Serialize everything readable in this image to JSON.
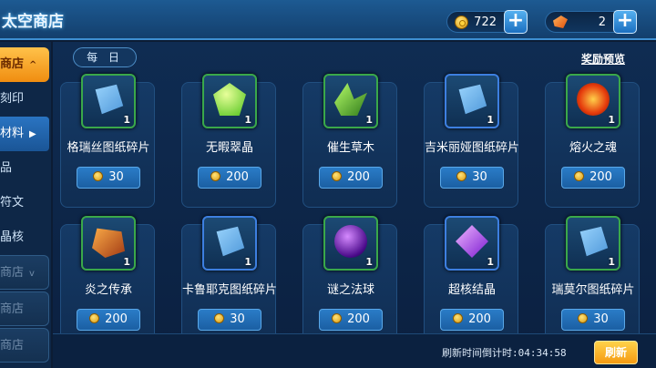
{
  "header": {
    "title": "太空商店",
    "currency1": {
      "icon": "coin-icon",
      "value": "722"
    },
    "currency2": {
      "icon": "gem-icon",
      "value": "2"
    }
  },
  "sidebar": {
    "items": [
      {
        "label": "商店"
      },
      {
        "label": "刻印"
      },
      {
        "label": "材料"
      },
      {
        "label": "品"
      },
      {
        "label": "符文"
      },
      {
        "label": "晶核"
      },
      {
        "label": "商店"
      },
      {
        "label": "商店"
      },
      {
        "label": "商店"
      }
    ]
  },
  "main": {
    "tab_daily": "每 日",
    "preview_link": "奖励预览",
    "items": [
      {
        "name": "格瑞丝图纸碎片",
        "price": "30",
        "count": "1",
        "icon": "blueprint-icon"
      },
      {
        "name": "无暇翠晶",
        "price": "200",
        "count": "1",
        "icon": "green-crystal-icon"
      },
      {
        "name": "催生草木",
        "price": "200",
        "count": "1",
        "icon": "herb-icon"
      },
      {
        "name": "吉米丽娅图纸碎片",
        "price": "30",
        "count": "1",
        "icon": "blueprint-icon"
      },
      {
        "name": "熔火之魂",
        "price": "200",
        "count": "1",
        "icon": "fire-soul-icon"
      },
      {
        "name": "炎之传承",
        "price": "200",
        "count": "1",
        "icon": "flame-rock-icon"
      },
      {
        "name": "卡鲁耶克图纸碎片",
        "price": "30",
        "count": "1",
        "icon": "blueprint-icon"
      },
      {
        "name": "谜之法球",
        "price": "200",
        "count": "1",
        "icon": "dark-orb-icon"
      },
      {
        "name": "超核结晶",
        "price": "200",
        "count": "1",
        "icon": "core-crystal-icon"
      },
      {
        "name": "瑞莫尔图纸碎片",
        "price": "30",
        "count": "1",
        "icon": "blueprint-icon"
      }
    ]
  },
  "footer": {
    "refresh_text": "刷新时间倒计时:04:34:58",
    "refresh_button": "刷新"
  },
  "colors": {
    "accent": "#f59a12",
    "panel": "#153a66",
    "header": "#1d5a92"
  }
}
